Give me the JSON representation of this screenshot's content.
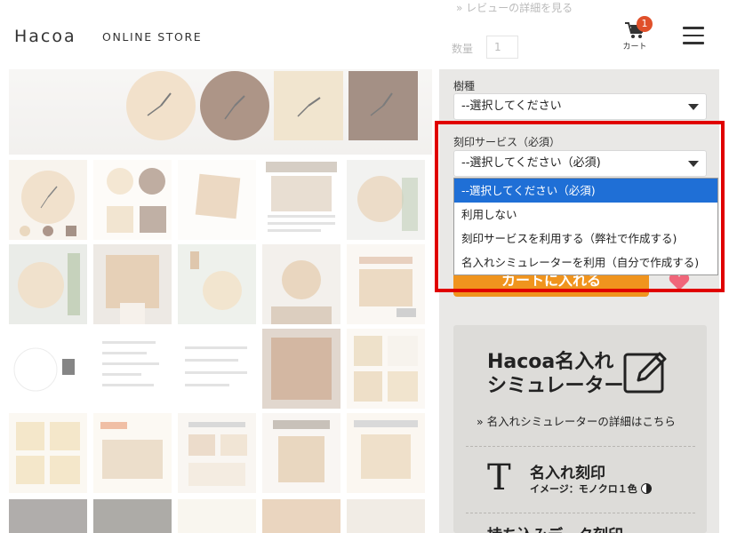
{
  "header": {
    "logo": "Hacoa",
    "logo_sub": "ONLINE STORE",
    "cart_label": "カート",
    "cart_count": "1"
  },
  "top_faded": {
    "review_link": "» レビューの詳細を見る",
    "qty_label": "数量",
    "qty_value": "1"
  },
  "form": {
    "wood_label": "樹種",
    "wood_value": "--選択してください",
    "engrave_label": "刻印サービス（必須）",
    "engrave_value": "--選択してください（必須)",
    "dropdown_options": [
      "--選択してください（必須)",
      "利用しない",
      "刻印サービスを利用する（弊社で作成する)",
      "名入れシミュレーターを利用（自分で作成する)"
    ],
    "cart_button": "カートに入れる"
  },
  "simulator": {
    "title_line1": "Hacoa名入れ",
    "title_line2": "シミュレーター",
    "detail_link": "名入れシミュレーターの詳細はこちら",
    "engrave_title": "名入れ刻印",
    "engrave_sub": "イメージ：モノクロ１色",
    "bottom_title": "持ち込みデータ刻印"
  },
  "colors": {
    "accent_orange": "#f0941e",
    "badge": "#e0502a",
    "selected_option": "#1f6fd6",
    "highlight_border": "#e00000"
  }
}
